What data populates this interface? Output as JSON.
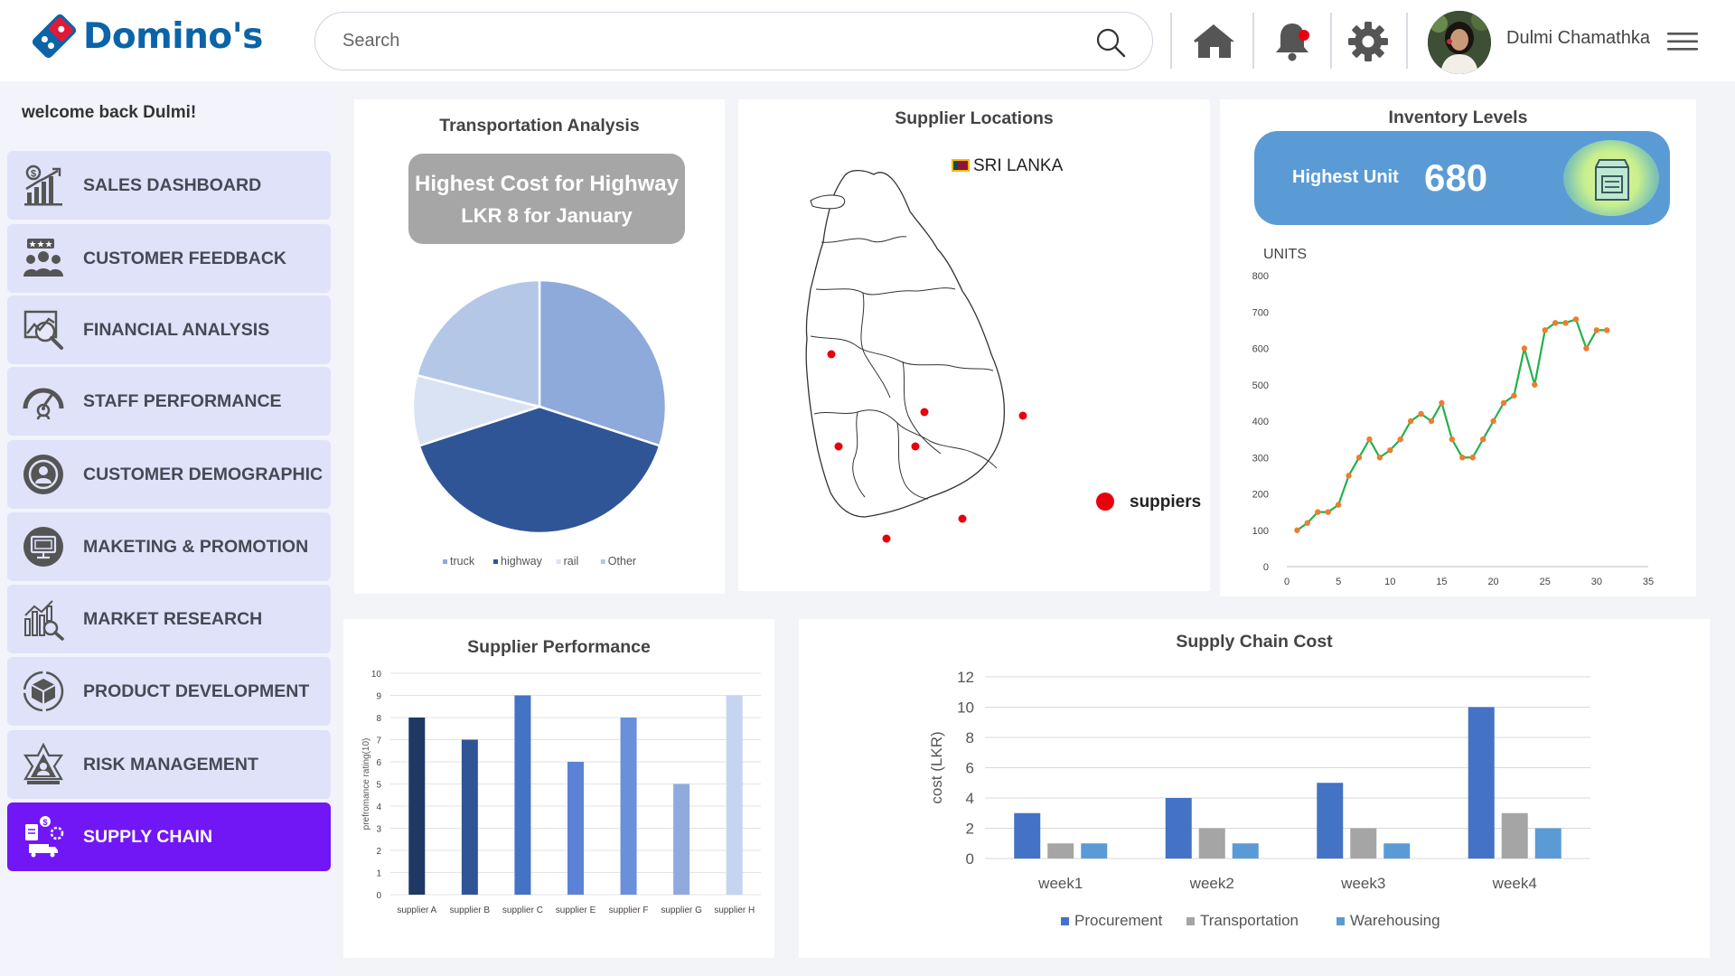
{
  "brand": {
    "name": "Domino's"
  },
  "search": {
    "placeholder": "Search"
  },
  "header": {
    "username": "Dulmi Chamathka",
    "icons": [
      "home-icon",
      "bell-icon",
      "gear-icon",
      "menu-icon"
    ]
  },
  "sidebar": {
    "welcome": "welcome back Dulmi!",
    "items": [
      {
        "label": "SALES DASHBOARD",
        "icon": "sales-chart-icon",
        "active": false
      },
      {
        "label": "CUSTOMER FEEDBACK",
        "icon": "customer-group-icon",
        "active": false
      },
      {
        "label": "FINANCIAL ANALYSIS",
        "icon": "financial-analysis-icon",
        "active": false
      },
      {
        "label": "STAFF PERFORMANCE",
        "icon": "gauge-icon",
        "active": false
      },
      {
        "label": "CUSTOMER DEMOGRAPHIC",
        "icon": "customer-target-icon",
        "active": false
      },
      {
        "label": "MAKETING & PROMOTION",
        "icon": "monitor-ad-icon",
        "active": false
      },
      {
        "label": "MARKET RESEARCH",
        "icon": "research-chart-icon",
        "active": false
      },
      {
        "label": "PRODUCT DEVELOPMENT",
        "icon": "product-box-icon",
        "active": false
      },
      {
        "label": "RISK MANAGEMENT",
        "icon": "risk-icon",
        "active": false
      },
      {
        "label": "SUPPLY CHAIN",
        "icon": "supply-chain-icon",
        "active": true
      }
    ]
  },
  "transport": {
    "title": "Transportation Analysis",
    "badge_line1": "Highest Cost for Highway",
    "badge_line2": "LKR  8 for January"
  },
  "locations": {
    "title": "Supplier Locations",
    "country": "SRI LANKA",
    "legend": "suppiers"
  },
  "inventory": {
    "title": "Inventory Levels",
    "badge_label": "Highest Unit",
    "badge_value": "680",
    "y_title": "UNITS"
  },
  "performance": {
    "title": "Supplier Performance"
  },
  "cost": {
    "title": "Supply Chain Cost"
  },
  "chart_data": [
    {
      "type": "pie",
      "title": "Transportation Analysis",
      "categories": [
        "truck",
        "highway",
        "rail",
        "Other"
      ],
      "values": [
        30,
        40,
        9,
        21
      ],
      "colors": [
        "#8eaadb",
        "#2f5597",
        "#dae3f3",
        "#b4c7e7"
      ],
      "legend": "bottom"
    },
    {
      "type": "scatter",
      "title": "Supplier Locations",
      "series": [
        {
          "name": "suppiers",
          "values": []
        }
      ],
      "color": "#e8000d",
      "legend": "right"
    },
    {
      "type": "line",
      "title": "Inventory Levels",
      "ylabel": "UNITS",
      "xlim": [
        0,
        35
      ],
      "ylim": [
        0,
        800
      ],
      "xticks": [
        0,
        5,
        10,
        15,
        20,
        25,
        30,
        35
      ],
      "yticks": [
        0,
        100,
        200,
        300,
        400,
        500,
        600,
        700,
        800
      ],
      "x": [
        1,
        2,
        3,
        4,
        5,
        6,
        7,
        8,
        9,
        10,
        11,
        12,
        13,
        14,
        15,
        16,
        17,
        18,
        19,
        20,
        21,
        22,
        23,
        24,
        25,
        26,
        27,
        28,
        29,
        30,
        31
      ],
      "values": [
        100,
        120,
        150,
        150,
        170,
        250,
        300,
        350,
        300,
        320,
        350,
        400,
        420,
        400,
        450,
        350,
        300,
        300,
        350,
        400,
        450,
        470,
        600,
        500,
        650,
        670,
        670,
        680,
        600,
        650,
        650
      ],
      "line_color": "#22b14c",
      "marker_color": "#ed7d31",
      "grid": false
    },
    {
      "type": "bar",
      "title": "Supplier Performance",
      "ylabel": "prefromance rating(10)",
      "categories": [
        "supplier A",
        "supplier B",
        "supplier C",
        "supplier E",
        "supplier F",
        "supplier G",
        "supplier H"
      ],
      "values": [
        8,
        7,
        9,
        6,
        8,
        5,
        9
      ],
      "colors": [
        "#203864",
        "#2f5597",
        "#4472c4",
        "#5b82d6",
        "#6a8fdb",
        "#8faadc",
        "#c5d4f0"
      ],
      "ylim": [
        0,
        10
      ],
      "yticks": [
        0,
        1,
        2,
        3,
        4,
        5,
        6,
        7,
        8,
        9,
        10
      ],
      "grid": true
    },
    {
      "type": "bar",
      "title": "Supply Chain Cost",
      "ylabel": "cost (LKR)",
      "categories": [
        "week1",
        "week2",
        "week3",
        "week4"
      ],
      "series": [
        {
          "name": "Procurement",
          "values": [
            3,
            4,
            5,
            10
          ],
          "color": "#4472c4"
        },
        {
          "name": "Transportation",
          "values": [
            1,
            2,
            2,
            3
          ],
          "color": "#a5a5a5"
        },
        {
          "name": "Warehousing",
          "values": [
            1,
            1,
            1,
            2
          ],
          "color": "#5b9bd5"
        }
      ],
      "ylim": [
        0,
        12
      ],
      "yticks": [
        0,
        2,
        4,
        6,
        8,
        10,
        12
      ],
      "legend": "bottom",
      "grid": true
    }
  ]
}
